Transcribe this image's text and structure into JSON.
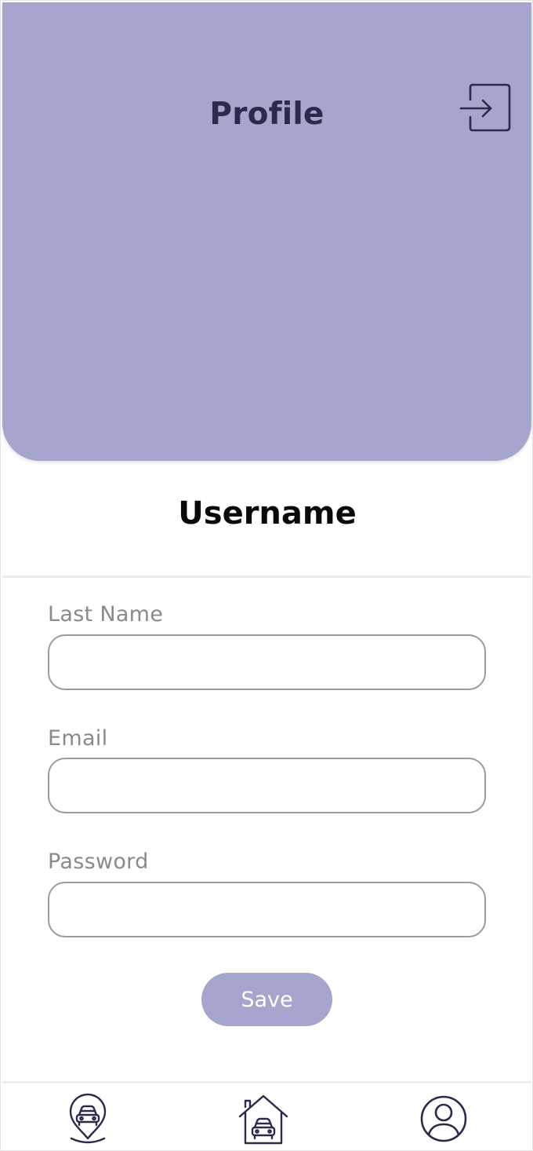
{
  "header": {
    "title": "Profile",
    "logout_icon": "logout-icon",
    "background_color": "#a6a5cd",
    "title_color": "#2b2a4c"
  },
  "profile": {
    "username": "Username"
  },
  "form": {
    "fields": [
      {
        "label": "Last Name",
        "value": "",
        "placeholder": ""
      },
      {
        "label": "Email",
        "value": "",
        "placeholder": ""
      },
      {
        "label": "Password",
        "value": "",
        "placeholder": ""
      }
    ],
    "save_label": "Save"
  },
  "bottom_nav": {
    "items": [
      {
        "icon": "map-pin-car-icon"
      },
      {
        "icon": "garage-car-icon"
      },
      {
        "icon": "user-profile-icon"
      }
    ]
  }
}
